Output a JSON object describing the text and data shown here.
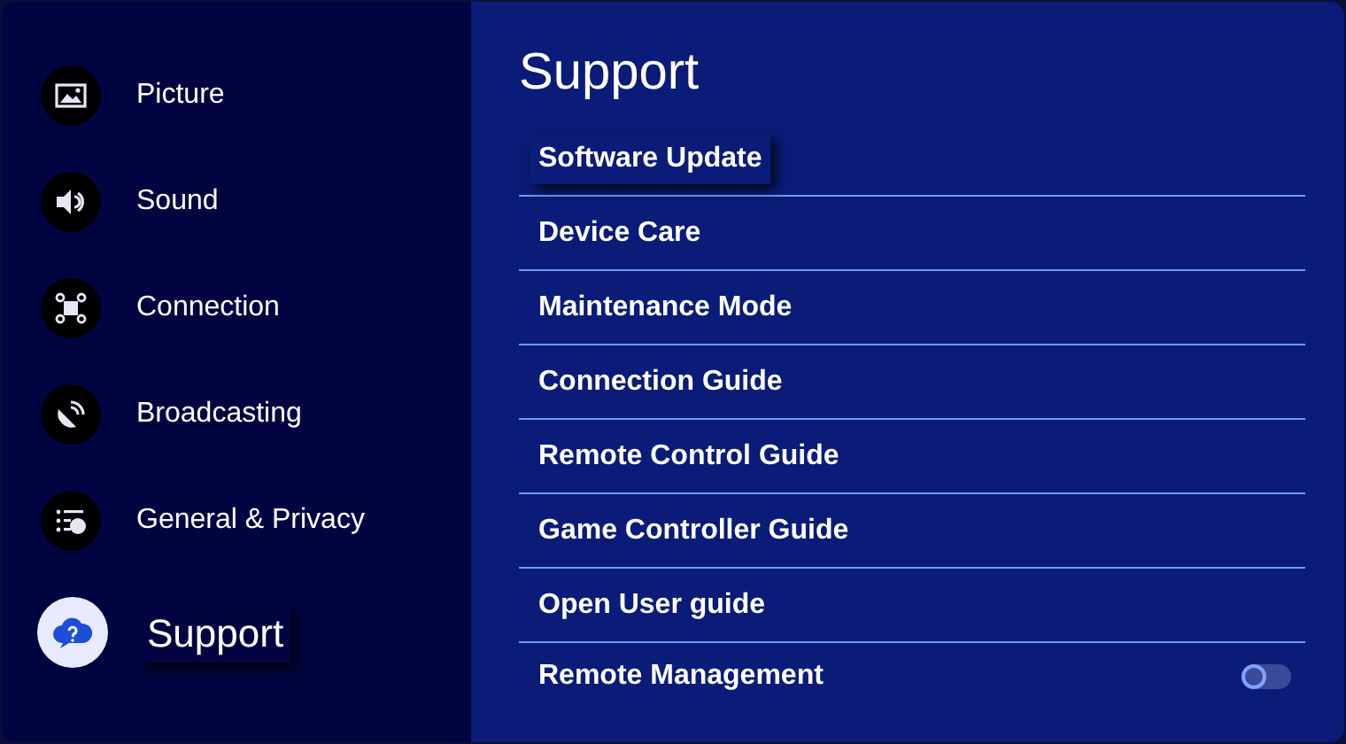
{
  "sidebar": {
    "items": [
      {
        "label": "Picture",
        "selected": false
      },
      {
        "label": "Sound",
        "selected": false
      },
      {
        "label": "Connection",
        "selected": false
      },
      {
        "label": "Broadcasting",
        "selected": false
      },
      {
        "label": "General & Privacy",
        "selected": false
      },
      {
        "label": "Support",
        "selected": true
      }
    ]
  },
  "panel": {
    "title": "Support",
    "items": [
      {
        "label": "Software Update",
        "kind": "link",
        "selected": true
      },
      {
        "label": "Device Care",
        "kind": "link",
        "selected": false
      },
      {
        "label": "Maintenance Mode",
        "kind": "link",
        "selected": false
      },
      {
        "label": "Connection Guide",
        "kind": "link",
        "selected": false
      },
      {
        "label": "Remote Control Guide",
        "kind": "link",
        "selected": false
      },
      {
        "label": "Game Controller Guide",
        "kind": "link",
        "selected": false
      },
      {
        "label": "Open User guide",
        "kind": "link",
        "selected": false
      },
      {
        "label": "Remote Management",
        "kind": "toggle",
        "selected": false,
        "on": false
      }
    ]
  }
}
